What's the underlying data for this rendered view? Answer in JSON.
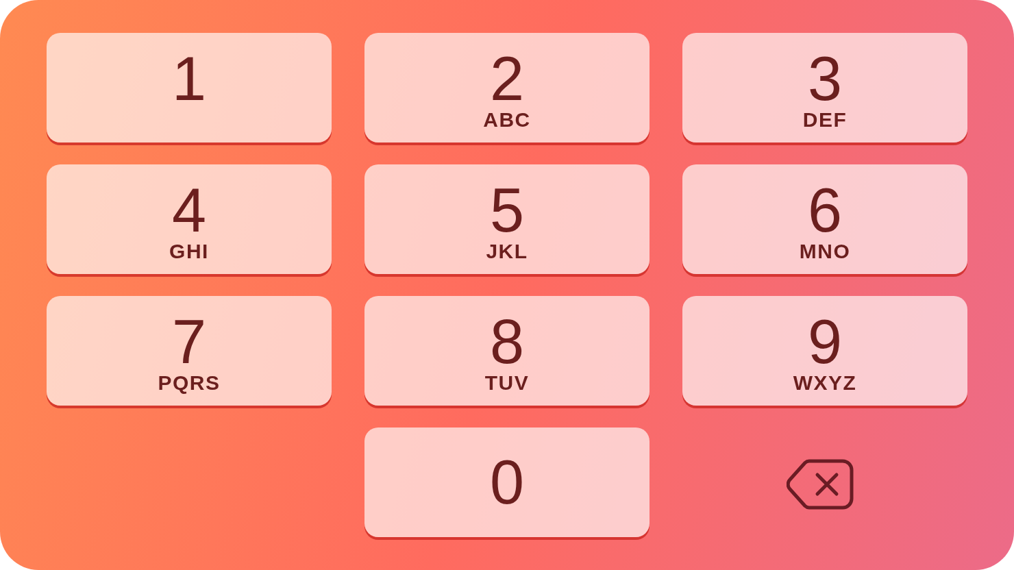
{
  "keypad": {
    "keys": [
      {
        "kind": "key",
        "digit": "1"
      },
      {
        "kind": "key",
        "digit": "2",
        "letters": "ABC"
      },
      {
        "kind": "key",
        "digit": "3",
        "letters": "DEF"
      },
      {
        "kind": "key",
        "digit": "4",
        "letters": "GHI"
      },
      {
        "kind": "key",
        "digit": "5",
        "letters": "JKL"
      },
      {
        "kind": "key",
        "digit": "6",
        "letters": "MNO"
      },
      {
        "kind": "key",
        "digit": "7",
        "letters": "PQRS"
      },
      {
        "kind": "key",
        "digit": "8",
        "letters": "TUV"
      },
      {
        "kind": "key",
        "digit": "9",
        "letters": "WXYZ"
      },
      {
        "kind": "spacer"
      },
      {
        "kind": "key_centered",
        "digit": "0"
      },
      {
        "kind": "backspace"
      }
    ]
  }
}
